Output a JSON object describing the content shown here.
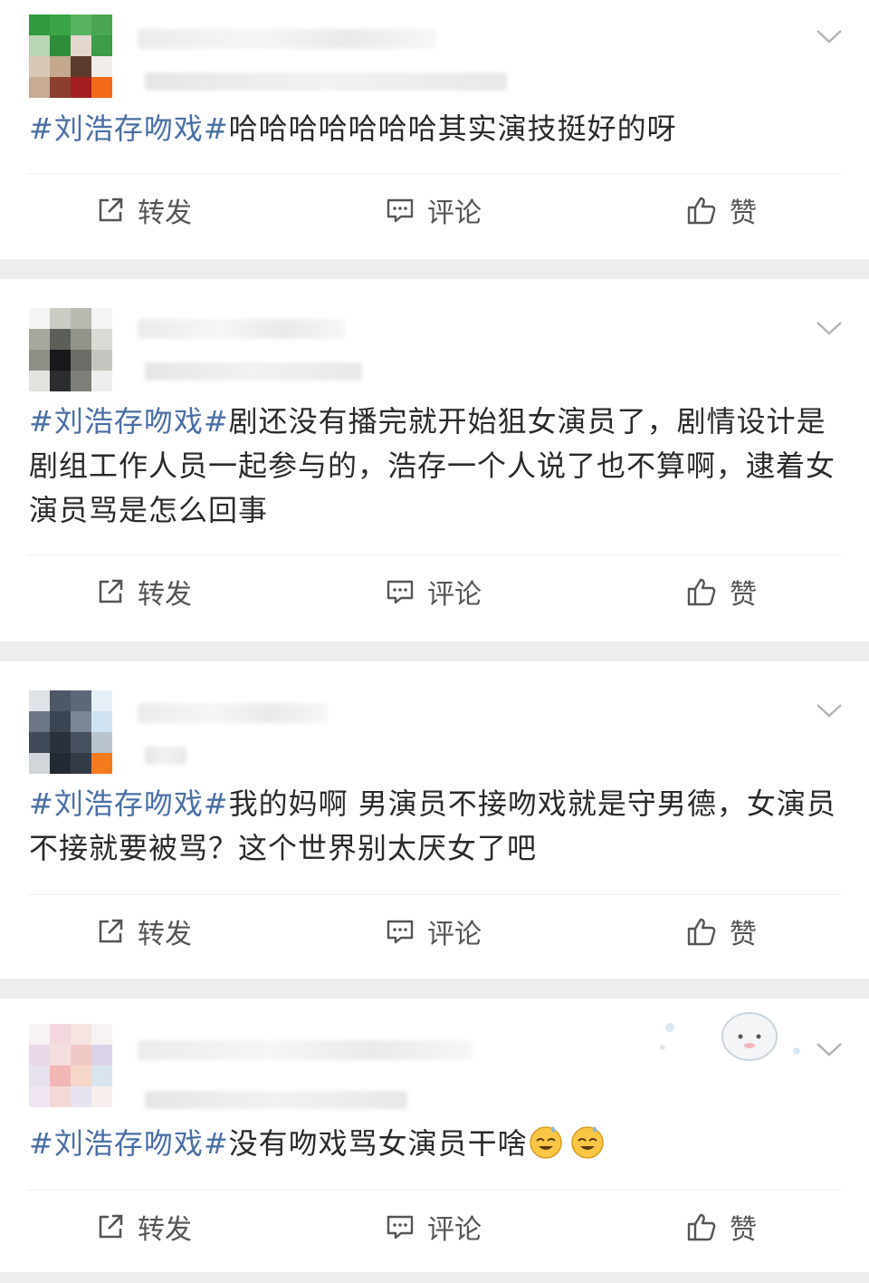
{
  "posts": [
    {
      "topic": "#刘浩存吻戏#",
      "text": "哈哈哈哈哈哈哈其实演技挺好的呀",
      "actions": {
        "repost": "转发",
        "comment": "评论",
        "like": "赞"
      }
    },
    {
      "topic": "#刘浩存吻戏#",
      "text": "剧还没有播完就开始狙女演员了，剧情设计是剧组工作人员一起参与的，浩存一个人说了也不算啊，逮着女演员骂是怎么回事",
      "actions": {
        "repost": "转发",
        "comment": "评论",
        "like": "赞"
      }
    },
    {
      "topic": "#刘浩存吻戏#",
      "text": "我的妈啊 男演员不接吻戏就是守男德，女演员不接就要被骂？这个世界别太厌女了吧",
      "actions": {
        "repost": "转发",
        "comment": "评论",
        "like": "赞"
      }
    },
    {
      "topic": "#刘浩存吻戏#",
      "text": "没有吻戏骂女演员干啥",
      "emoji_icons": [
        "sweat-smile-emoji",
        "sweat-smile-emoji"
      ],
      "actions": {
        "repost": "转发",
        "comment": "评论",
        "like": "赞"
      }
    }
  ],
  "icons": {
    "repost": "share-square-icon",
    "comment": "comment-bubble-icon",
    "like": "thumbs-up-icon",
    "menu": "chevron-down-icon"
  },
  "colors": {
    "topic": "#4a6fa5",
    "text": "#2a2a2a",
    "action": "#555555",
    "background": "#ededed"
  }
}
